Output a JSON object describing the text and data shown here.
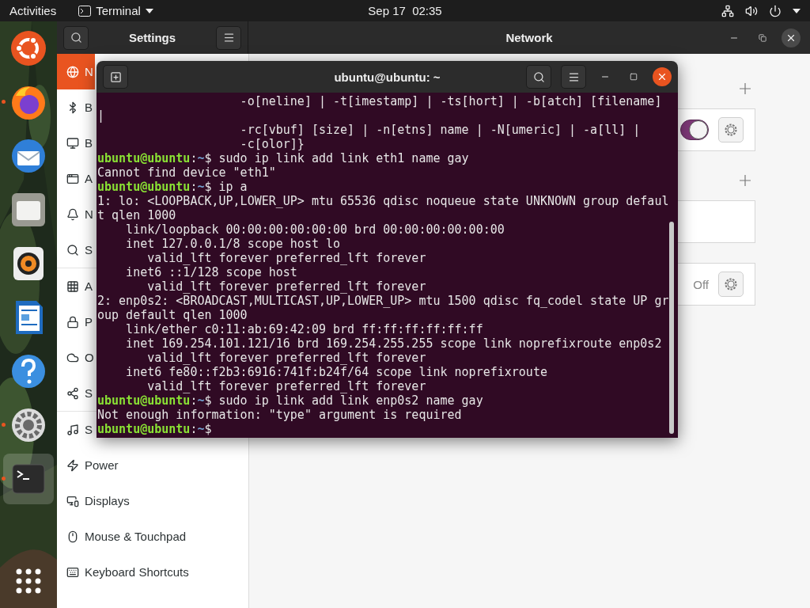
{
  "topbar": {
    "activities": "Activities",
    "app_menu": "Terminal",
    "clock": "Sep 17  02:35"
  },
  "dock": {
    "items": [
      {
        "kind": "ubuntu",
        "running": false,
        "selected": false
      },
      {
        "kind": "browser",
        "running": true,
        "selected": false
      },
      {
        "kind": "mail",
        "running": false,
        "selected": false
      },
      {
        "kind": "files",
        "running": false,
        "selected": false
      },
      {
        "kind": "music",
        "running": false,
        "selected": false
      },
      {
        "kind": "writer",
        "running": false,
        "selected": false
      },
      {
        "kind": "help",
        "running": false,
        "selected": false
      },
      {
        "kind": "settings",
        "running": true,
        "selected": false
      },
      {
        "kind": "terminal",
        "running": true,
        "selected": true
      }
    ]
  },
  "settings": {
    "title": "Settings",
    "page_title": "Network",
    "sidebar": {
      "sections": [
        {
          "items": [
            {
              "label": "N",
              "selected": true
            },
            {
              "label": "B",
              "selected": false
            },
            {
              "label": "B",
              "selected": false
            },
            {
              "label": "A",
              "selected": false
            },
            {
              "label": "N",
              "selected": false
            },
            {
              "label": "S",
              "selected": false
            }
          ]
        },
        {
          "items": [
            {
              "label": "A",
              "selected": false
            },
            {
              "label": "P",
              "selected": false
            },
            {
              "label": "O",
              "selected": false
            },
            {
              "label": "S",
              "selected": false
            }
          ]
        },
        {
          "items": [
            {
              "label": "S",
              "selected": false
            },
            {
              "label": "Power",
              "selected": false
            },
            {
              "label": "Displays",
              "selected": false
            },
            {
              "label": "Mouse & Touchpad",
              "selected": false
            },
            {
              "label": "Keyboard Shortcuts",
              "selected": false
            }
          ]
        }
      ]
    },
    "network": {
      "sections": [
        {
          "add": true,
          "rows": [
            {
              "kind": "toggle",
              "on": true
            }
          ]
        },
        {
          "add": true,
          "rows": [
            {
              "kind": "empty"
            }
          ]
        },
        {
          "add": false,
          "rows": [
            {
              "kind": "status",
              "status": "Off"
            }
          ]
        }
      ]
    }
  },
  "terminal": {
    "title": "ubuntu@ubuntu: ~",
    "lines": [
      {
        "kind": "output",
        "text": "                    -o[neline] | -t[imestamp] | -ts[hort] | -b[atch] [filename]"
      },
      {
        "kind": "output",
        "text": "|"
      },
      {
        "kind": "output",
        "text": "                    -rc[vbuf] [size] | -n[etns] name | -N[umeric] | -a[ll] |"
      },
      {
        "kind": "output",
        "text": "                    -c[olor]}"
      },
      {
        "kind": "prompt",
        "user": "ubuntu@ubuntu",
        "colon": ":",
        "path": "~",
        "sigil": "$",
        "command": "sudo ip link add link eth1 name gay"
      },
      {
        "kind": "output",
        "text": "Cannot find device \"eth1\""
      },
      {
        "kind": "prompt",
        "user": "ubuntu@ubuntu",
        "colon": ":",
        "path": "~",
        "sigil": "$",
        "command": "ip a"
      },
      {
        "kind": "output",
        "text": "1: lo: <LOOPBACK,UP,LOWER_UP> mtu 65536 qdisc noqueue state UNKNOWN group defaul"
      },
      {
        "kind": "output",
        "text": "t qlen 1000"
      },
      {
        "kind": "output",
        "text": "    link/loopback 00:00:00:00:00:00 brd 00:00:00:00:00:00"
      },
      {
        "kind": "output",
        "text": "    inet 127.0.0.1/8 scope host lo"
      },
      {
        "kind": "output",
        "text": "       valid_lft forever preferred_lft forever"
      },
      {
        "kind": "output",
        "text": "    inet6 ::1/128 scope host"
      },
      {
        "kind": "output",
        "text": "       valid_lft forever preferred_lft forever"
      },
      {
        "kind": "output",
        "text": "2: enp0s2: <BROADCAST,MULTICAST,UP,LOWER_UP> mtu 1500 qdisc fq_codel state UP gr"
      },
      {
        "kind": "output",
        "text": "oup default qlen 1000"
      },
      {
        "kind": "output",
        "text": "    link/ether c0:11:ab:69:42:09 brd ff:ff:ff:ff:ff:ff"
      },
      {
        "kind": "output",
        "text": "    inet 169.254.101.121/16 brd 169.254.255.255 scope link noprefixroute enp0s2"
      },
      {
        "kind": "output",
        "text": "       valid_lft forever preferred_lft forever"
      },
      {
        "kind": "output",
        "text": "    inet6 fe80::f2b3:6916:741f:b24f/64 scope link noprefixroute"
      },
      {
        "kind": "output",
        "text": "       valid_lft forever preferred_lft forever"
      },
      {
        "kind": "prompt",
        "user": "ubuntu@ubuntu",
        "colon": ":",
        "path": "~",
        "sigil": "$",
        "command": "sudo ip link add link enp0s2 name gay"
      },
      {
        "kind": "output",
        "text": "Not enough information: \"type\" argument is required"
      },
      {
        "kind": "prompt",
        "user": "ubuntu@ubuntu",
        "colon": ":",
        "path": "~",
        "sigil": "$"
      }
    ]
  }
}
